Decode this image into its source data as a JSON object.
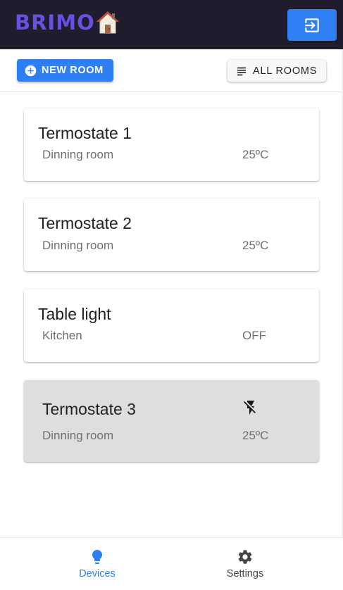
{
  "header": {
    "logo_text": "BRIMO",
    "brand_color": "#6a4fe0",
    "logout_icon": "logout-icon",
    "accent_color": "#2f80f5"
  },
  "toolbar": {
    "new_room_label": "NEW ROOM",
    "new_room_icon": "add-circle-icon",
    "all_rooms_label": "ALL ROOMS",
    "all_rooms_icon": "list-icon"
  },
  "devices": [
    {
      "name": "Termostate 1",
      "room": "Dinning room",
      "value": "25ºC"
    },
    {
      "name": "Termostate 2",
      "room": "Dinning room",
      "value": "25ºC"
    },
    {
      "name": "Table light",
      "room": "Kitchen",
      "value": "OFF"
    },
    {
      "name": "Termostate 3",
      "room": "Dinning room",
      "value": "25ºC",
      "status_icon": "flash-off-icon"
    }
  ],
  "bottom_nav": {
    "items": [
      {
        "label": "Devices",
        "icon": "lightbulb-icon",
        "active": true
      },
      {
        "label": "Settings",
        "icon": "gear-icon",
        "active": false
      }
    ]
  }
}
